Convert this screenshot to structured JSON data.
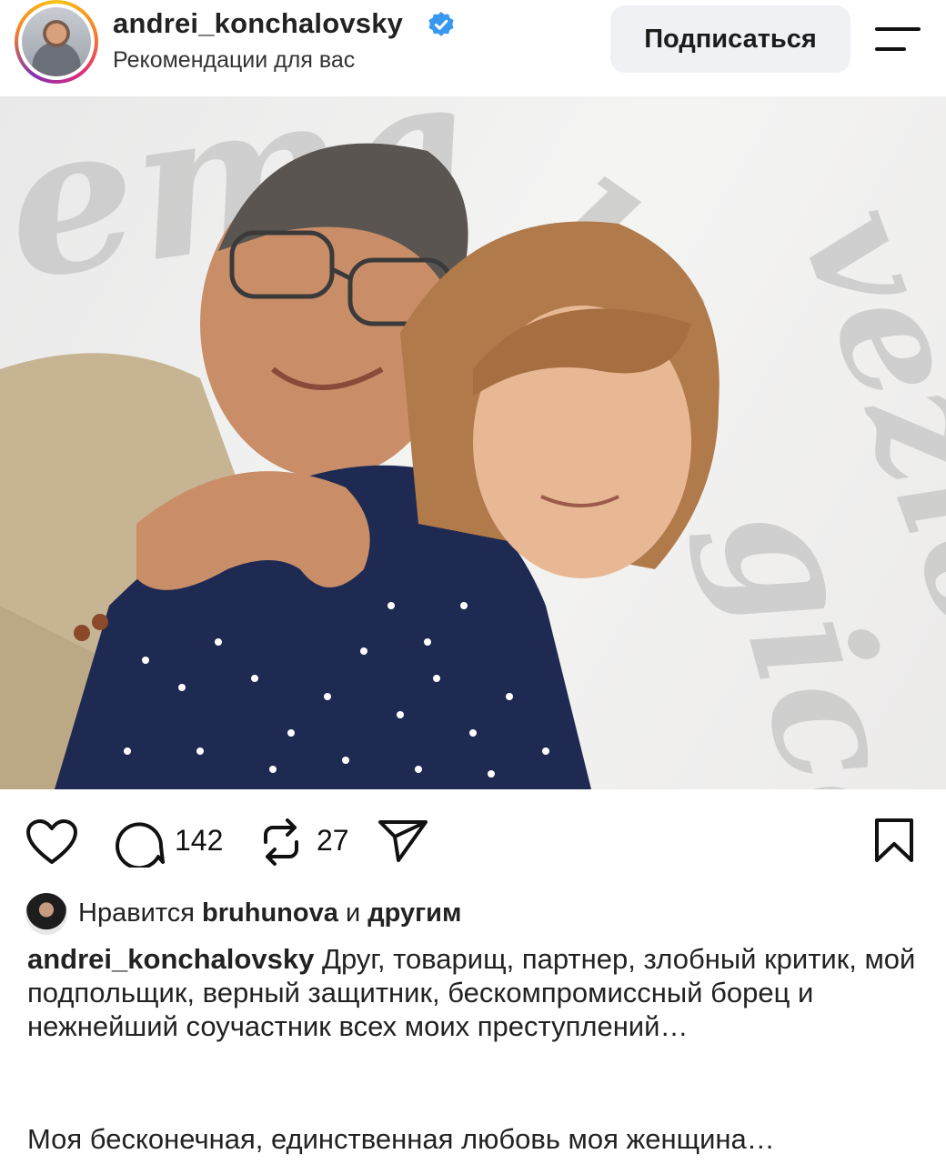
{
  "header": {
    "username": "andrei_konchalovsky",
    "subtitle": "Рекомендации для вас",
    "follow_label": "Подписаться"
  },
  "post": {
    "photo_icon": "photo",
    "background_words": [
      "ema",
      "la",
      "gica",
      "vezio"
    ],
    "comments_count": "142",
    "reposts_count": "27"
  },
  "likes": {
    "prefix": "Нравится",
    "user": "bruhunova",
    "conj": "и",
    "others": "другим"
  },
  "caption": {
    "author": "andrei_konchalovsky",
    "text": "Друг, товарищ, партнер, злобный критик, мой подпольщик, верный защитник, бескомпромиссный борец и нежнейший соучастник всех моих преступлений…",
    "second": "Моя бесконечная, единственная любовь моя женщина…"
  },
  "colors": {
    "verified": "#3897f0",
    "button_bg": "#eff1f4"
  }
}
